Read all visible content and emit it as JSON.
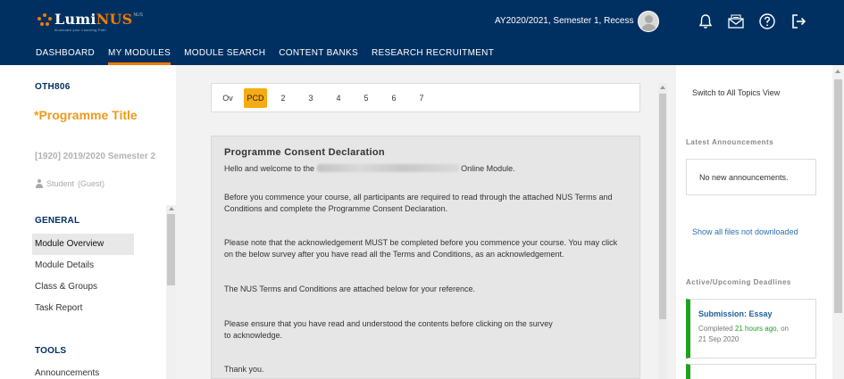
{
  "header": {
    "logo_prefix": "Lumi",
    "logo_accent": "NUS",
    "logo_tagline": "Illuminate your Learning Path",
    "logo_sup": "NUS",
    "term": "AY2020/2021, Semester 1, Recess",
    "icons": [
      "bell-icon",
      "mail-icon",
      "help-icon",
      "logout-icon"
    ],
    "colors": {
      "bar": "#003062",
      "accent": "#ef7c00"
    }
  },
  "nav": {
    "items": [
      "DASHBOARD",
      "MY MODULES",
      "MODULE SEARCH",
      "CONTENT BANKS",
      "RESEARCH RECRUITMENT"
    ],
    "active": "MY MODULES"
  },
  "sidebar": {
    "module_code": "OTH806",
    "programme_title": "*Programme Title",
    "semester": "[1920] 2019/2020 Semester 2",
    "role": "Student",
    "role_note": "(Guest)",
    "general_heading": "GENERAL",
    "general_items": [
      "Module Overview",
      "Module Details",
      "Class & Groups",
      "Task Report"
    ],
    "active_item": "Module Overview",
    "tools_heading": "TOOLS",
    "tools_items": [
      "Announcements"
    ]
  },
  "tabs": {
    "items": [
      "Ov",
      "PCD",
      "2",
      "3",
      "4",
      "5",
      "6",
      "7"
    ],
    "active": "PCD"
  },
  "content": {
    "title": "Programme Consent Declaration",
    "greeting_before": "Hello and welcome to the",
    "greeting_after": "Online Module.",
    "p1": "Before you commence your course, all participants are required to read through the attached NUS Terms and Conditions and complete the Programme Consent Declaration.",
    "p2": "Please note that the acknowledgement MUST be completed before you commence your course. You may click on the below survey after you have read all the Terms and Conditions, as an acknowledgement.",
    "p3": "The NUS Terms and Conditions are attached below for your reference.",
    "p4a": "Please ensure that you have read and understood the contents before clicking on the survey",
    "p4b": "to acknowledge.",
    "p5": "Thank you."
  },
  "right_panel": {
    "switch_view": "Switch to All Topics View",
    "announcements_heading": "Latest Announcements",
    "no_announcements": "No new announcements.",
    "show_files": "Show all files not downloaded",
    "deadlines_heading": "Active/Upcoming Deadlines",
    "deadline": {
      "title": "Submission: Essay",
      "status_before": "Completed",
      "status_time": "21 hours ago",
      "status_after": ", on",
      "date": "21 Sep 2020"
    }
  }
}
